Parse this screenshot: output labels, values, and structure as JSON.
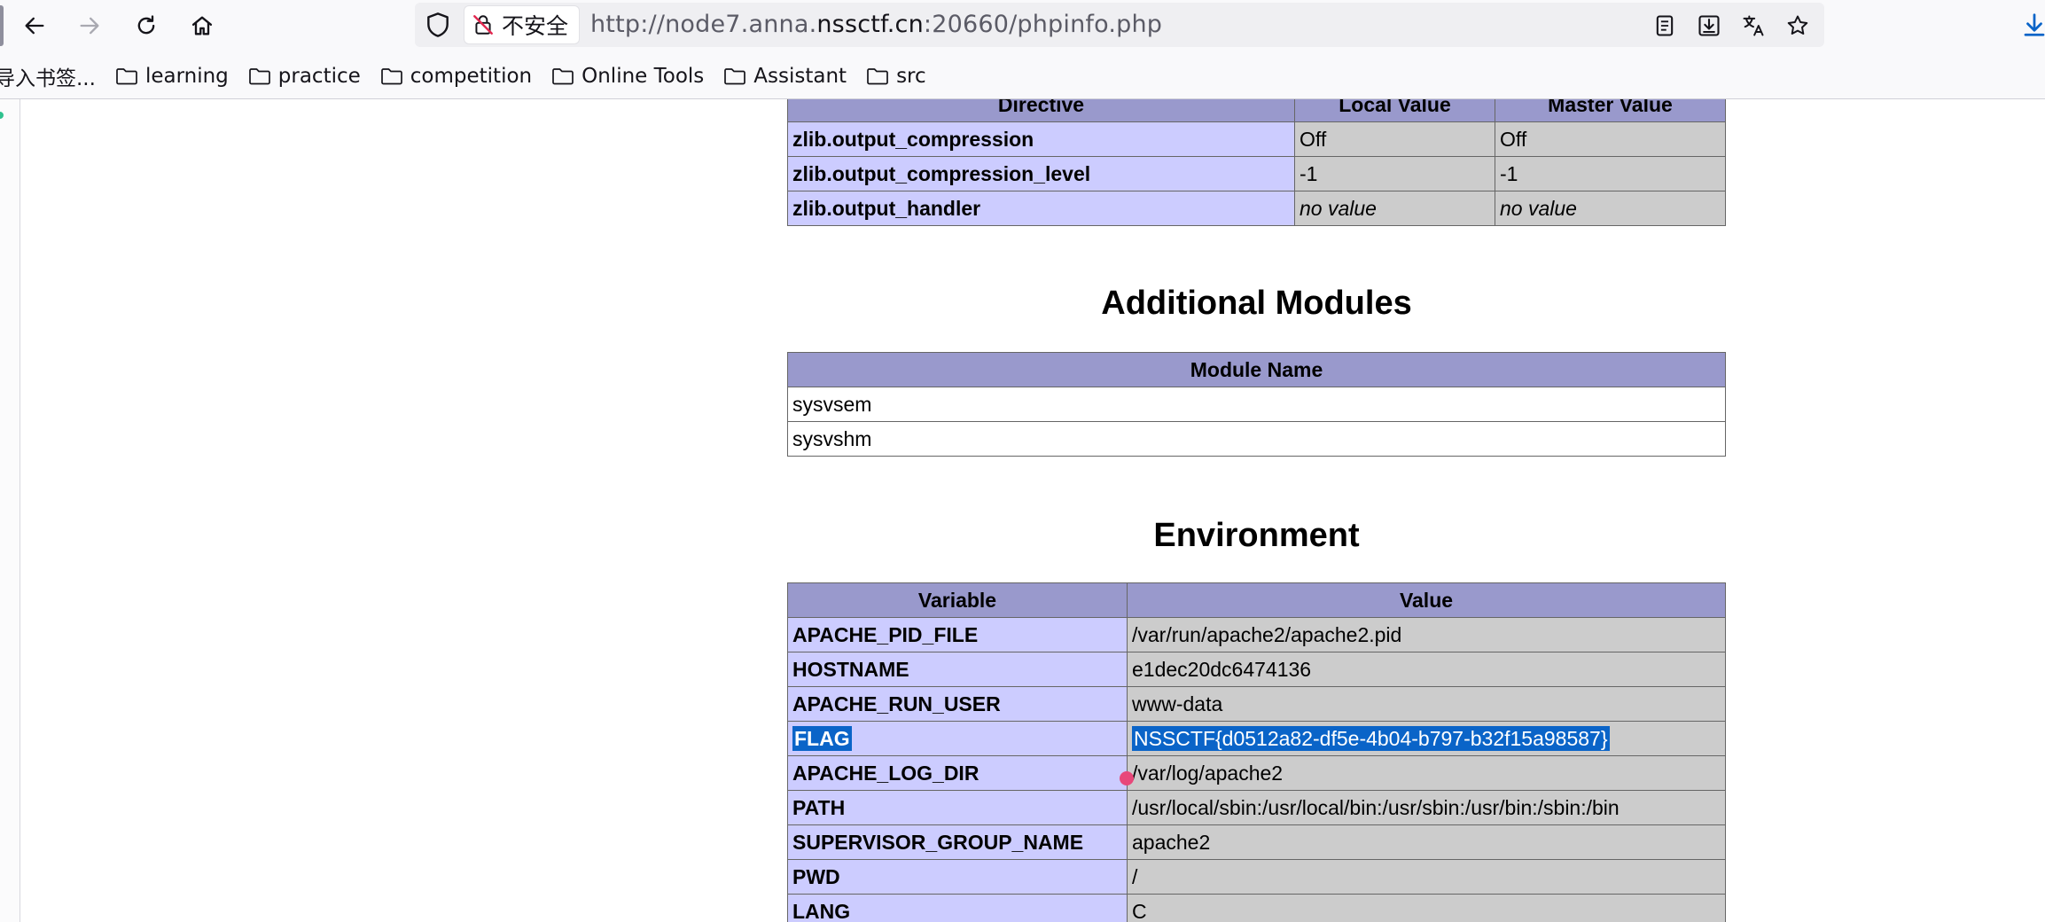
{
  "browser": {
    "insecure_label": "不安全",
    "url_prefix": "http://node7.anna.",
    "url_host": "nssctf.cn",
    "url_suffix": ":20660/phpinfo.php",
    "icons": [
      "back-icon",
      "forward-icon",
      "reload-icon",
      "home-icon",
      "shield-icon",
      "insecure-lock-icon",
      "reader-view-icon",
      "save-page-icon",
      "translate-icon",
      "bookmark-star-icon",
      "downloads-icon"
    ]
  },
  "bookmarks": [
    {
      "label": "导入书签..."
    },
    {
      "label": "learning"
    },
    {
      "label": "practice"
    },
    {
      "label": "competition"
    },
    {
      "label": "Online Tools"
    },
    {
      "label": "Assistant"
    },
    {
      "label": "src"
    }
  ],
  "zlib_table": {
    "headers": [
      "Directive",
      "Local Value",
      "Master Value"
    ],
    "rows": [
      {
        "name": "zlib.output_compression",
        "local": "Off",
        "master": "Off"
      },
      {
        "name": "zlib.output_compression_level",
        "local": "-1",
        "master": "-1"
      },
      {
        "name": "zlib.output_handler",
        "local": "no value",
        "master": "no value"
      }
    ]
  },
  "additional_modules": {
    "title": "Additional Modules",
    "header": "Module Name",
    "rows": [
      "sysvsem",
      "sysvshm"
    ]
  },
  "environment": {
    "title": "Environment",
    "headers": [
      "Variable",
      "Value"
    ],
    "rows": [
      {
        "name": "APACHE_PID_FILE",
        "value": "/var/run/apache2/apache2.pid"
      },
      {
        "name": "HOSTNAME",
        "value": "e1dec20dc6474136"
      },
      {
        "name": "APACHE_RUN_USER",
        "value": "www-data"
      },
      {
        "name": "FLAG",
        "value": "NSSCTF{d0512a82-df5e-4b04-b797-b32f15a98587}",
        "selected": true
      },
      {
        "name": "APACHE_LOG_DIR",
        "value": "/var/log/apache2"
      },
      {
        "name": "PATH",
        "value": "/usr/local/sbin:/usr/local/bin:/usr/sbin:/usr/bin:/sbin:/bin"
      },
      {
        "name": "SUPERVISOR_GROUP_NAME",
        "value": "apache2"
      },
      {
        "name": "PWD",
        "value": "/"
      },
      {
        "name": "LANG",
        "value": "C"
      }
    ]
  },
  "colors": {
    "header_bg": "#9999cc",
    "name_bg": "#ccccff",
    "value_bg": "#cccccc",
    "selection": "#0a64c8"
  }
}
